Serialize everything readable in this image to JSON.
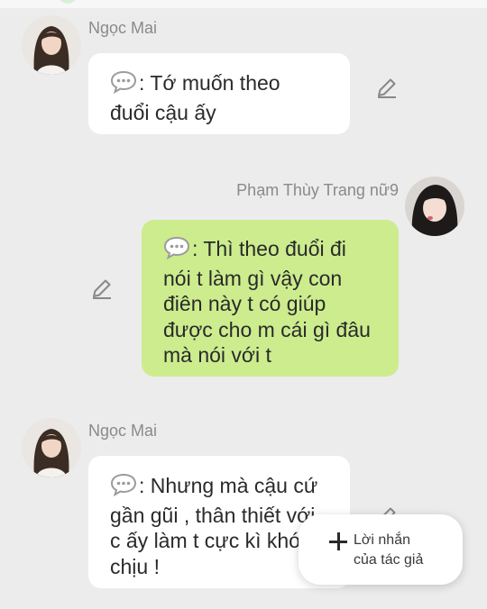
{
  "messages": [
    {
      "sender": "Ngọc Mai",
      "icon": "speech-bubble-icon",
      "lines": [
        ": Tớ muốn theo",
        "đuổi cậu ấy"
      ]
    },
    {
      "sender": "Phạm Thùy Trang nữ9",
      "icon": "speech-bubble-icon",
      "lines": [
        ": Thì theo đuổi đi",
        "nói t làm gì vậy con",
        "điên này t có giúp",
        "được cho m cái gì đâu",
        "mà nói với t"
      ]
    },
    {
      "sender": "Ngọc Mai",
      "icon": "speech-bubble-icon",
      "lines": [
        ": Nhưng mà cậu cứ",
        "gần gũi , thân thiết với",
        "c ấy làm t cực kì khó",
        "chịu !"
      ]
    }
  ],
  "fab": {
    "icon": "plus-icon",
    "label_line1": "Lời nhắn",
    "label_line2": "của tác giả"
  },
  "colors": {
    "background": "#ececec",
    "bubble_white": "#ffffff",
    "bubble_green": "#ccec8e",
    "sender_name": "#8a8a8a"
  }
}
